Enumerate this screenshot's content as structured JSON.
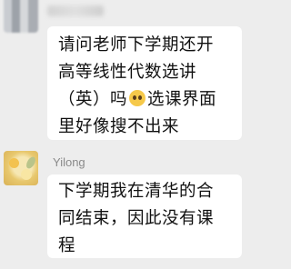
{
  "messages": [
    {
      "from": "me",
      "lines": [
        "请问老师下学期还开",
        "高等线性代数选讲",
        "（英）吗",
        "选课界面",
        "里好像搜不出来"
      ],
      "emoji": "pleading-face"
    },
    {
      "from": "Yilong",
      "lines": [
        "下学期我在清华的合",
        "同结束，因此没有课",
        "程"
      ]
    }
  ],
  "sender_name": "Yilong"
}
